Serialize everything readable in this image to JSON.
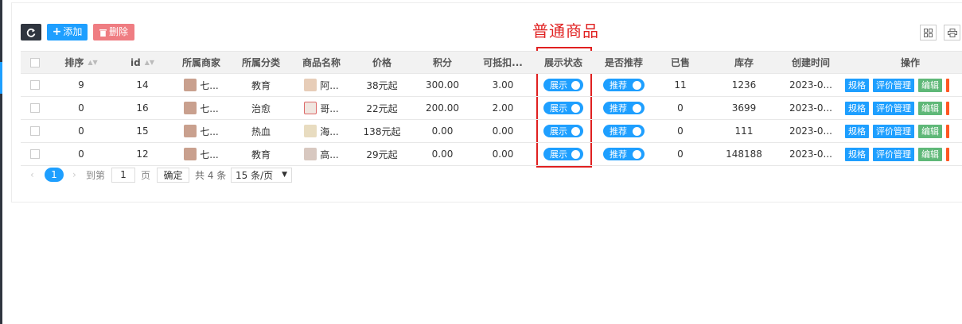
{
  "toolbar": {
    "refresh_icon": "refresh-icon",
    "add_label": "添加",
    "add_icon": "plus-icon",
    "delete_label": "删除",
    "delete_icon": "trash-icon",
    "columns_icon": "columns-icon",
    "print_icon": "print-icon"
  },
  "annotation": {
    "text": "普通商品",
    "color": "#e02020"
  },
  "table": {
    "headers": [
      "排序",
      "id",
      "所属商家",
      "所属分类",
      "商品名称",
      "价格",
      "积分",
      "可抵扣...",
      "展示状态",
      "是否推荐",
      "已售",
      "库存",
      "创建时间",
      "操作"
    ],
    "rows": [
      {
        "sort": "9",
        "id": "14",
        "merchant": "七...",
        "category": "教育",
        "name": "阿...",
        "price": "38元起",
        "points": "300.00",
        "deduct": "3.00",
        "show": "展示",
        "recommend": "推荐",
        "sold": "11",
        "stock": "1236",
        "created": "2023-0..."
      },
      {
        "sort": "0",
        "id": "16",
        "merchant": "七...",
        "category": "治愈",
        "name": "哥...",
        "price": "22元起",
        "points": "200.00",
        "deduct": "2.00",
        "show": "展示",
        "recommend": "推荐",
        "sold": "0",
        "stock": "3699",
        "created": "2023-0..."
      },
      {
        "sort": "0",
        "id": "15",
        "merchant": "七...",
        "category": "热血",
        "name": "海...",
        "price": "138元起",
        "points": "0.00",
        "deduct": "0.00",
        "show": "展示",
        "recommend": "推荐",
        "sold": "0",
        "stock": "111",
        "created": "2023-0..."
      },
      {
        "sort": "0",
        "id": "12",
        "merchant": "七...",
        "category": "教育",
        "name": "高...",
        "price": "29元起",
        "points": "0.00",
        "deduct": "0.00",
        "show": "展示",
        "recommend": "推荐",
        "sold": "0",
        "stock": "148188",
        "created": "2023-0..."
      }
    ],
    "ops": {
      "spec": "规格",
      "review": "评价管理",
      "edit": "编辑"
    }
  },
  "pager": {
    "current": "1",
    "goto_prefix": "到第",
    "goto_value": "1",
    "page_suffix": "页",
    "confirm": "确定",
    "total": "共 4 条",
    "per_page": "15 条/页"
  },
  "colors": {
    "primary": "#1e9fff",
    "danger": "#ef7d82",
    "dark": "#2f353f",
    "success": "#5fb878"
  }
}
